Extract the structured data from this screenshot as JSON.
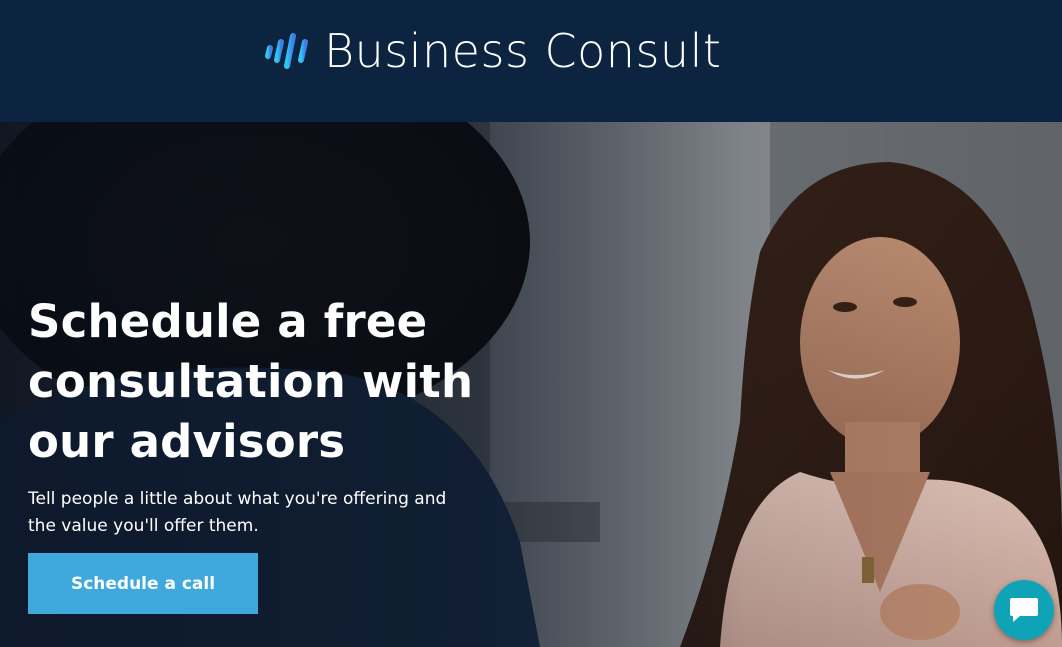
{
  "header": {
    "brand_name": "Business Consult",
    "logo_icon": "bars-logo-icon"
  },
  "hero": {
    "title": "Schedule a free consultation with our advisors",
    "subtitle": "Tell people a little about what you're offering and the value you'll offer them.",
    "cta_label": "Schedule a call"
  },
  "chat": {
    "icon": "chat-bubble-icon"
  },
  "colors": {
    "header_bg": "#0c2440",
    "accent": "#3fa9de",
    "chat_accent": "#0fa3b8",
    "logo_gradient_start": "#2ec7f0",
    "logo_gradient_end": "#3d7ee8"
  }
}
